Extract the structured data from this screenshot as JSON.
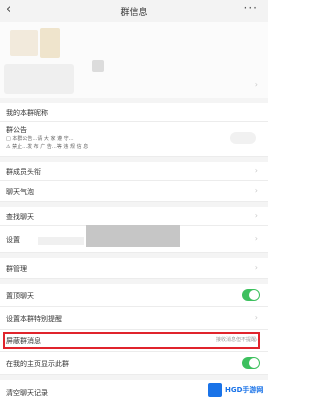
{
  "header": {
    "title": "群信息",
    "back_icon": "‹",
    "more_icon": "···"
  },
  "members": {
    "arrow": "›"
  },
  "rows": {
    "my_nickname": "我的本群昵称",
    "announcement": "群公告",
    "notice_line1": "□ 本群公告…请 大 家 遵 守…",
    "notice_line2": "⚠ 禁止…发 布 广 告…等 违 规 信 息",
    "group_avatar": "群成员头衔",
    "weather": "聊天气泡",
    "find_chat": "查找聊天",
    "set_current": "设置",
    "group_manage": "群管理",
    "pin_chat": "置顶聊天",
    "special_alert": "设置本群特别提醒",
    "message_notice": "屏蔽群消息",
    "message_notice_value": "接收消息但不提醒",
    "show_in_mine": "在我的主页显示此群",
    "clear_history": "清空聊天记录"
  },
  "watermark": {
    "text": "HGD手游网"
  },
  "colors": {
    "toggle_on": "#3dc05e",
    "highlight": "#e0242c"
  }
}
